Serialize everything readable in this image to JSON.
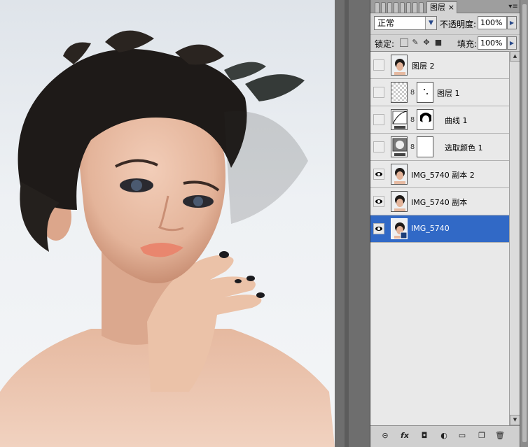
{
  "panel": {
    "tab_label": "图层",
    "tab_close": "×",
    "menu_icon": "menu-icon",
    "blend_mode": "正常",
    "opacity_label": "不透明度:",
    "opacity_value": "100%",
    "lock_label": "锁定:",
    "fill_label": "填充:",
    "fill_value": "100%"
  },
  "layers": [
    {
      "name": "图层 2",
      "visible": false,
      "selected": false,
      "type": "image"
    },
    {
      "name": "图层 1",
      "visible": false,
      "selected": false,
      "type": "transparent-with-mask"
    },
    {
      "name": "曲线 1",
      "visible": false,
      "selected": false,
      "type": "curves-adjustment"
    },
    {
      "name": "选取颜色 1",
      "visible": false,
      "selected": false,
      "type": "selective-color-adjustment"
    },
    {
      "name": "IMG_5740 副本 2",
      "visible": true,
      "selected": false,
      "type": "image"
    },
    {
      "name": "IMG_5740 副本",
      "visible": true,
      "selected": false,
      "type": "image"
    },
    {
      "name": "IMG_5740",
      "visible": true,
      "selected": true,
      "type": "image"
    }
  ],
  "bottom_icons": [
    "link-icon",
    "fx-icon",
    "add-mask-icon",
    "adjustment-layer-icon",
    "new-group-icon",
    "new-layer-icon",
    "trash-icon"
  ],
  "colors": {
    "selection": "#3169c6",
    "panel_bg": "#d4d4d4",
    "workspace_bg": "#6e6e6e"
  }
}
